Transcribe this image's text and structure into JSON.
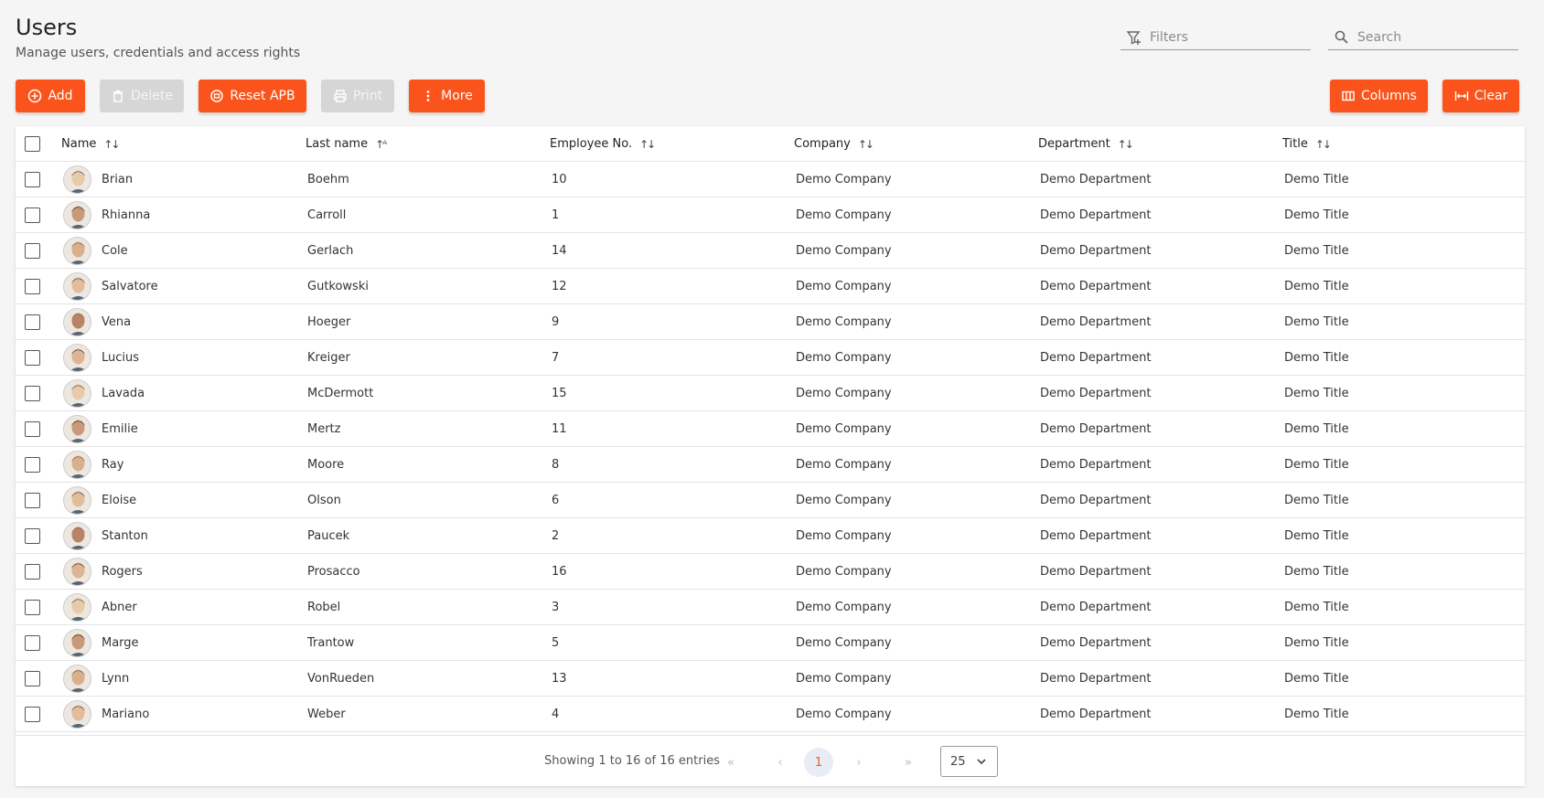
{
  "header": {
    "title": "Users",
    "subtitle": "Manage users, credentials and access rights"
  },
  "filters": {
    "placeholder": "Filters",
    "icon": "filter-plus-icon"
  },
  "search": {
    "placeholder": "Search",
    "icon": "search-icon"
  },
  "toolbar": {
    "add": "Add",
    "delete": "Delete",
    "reset_apb": "Reset APB",
    "print": "Print",
    "more": "More",
    "columns": "Columns",
    "clear": "Clear"
  },
  "colors": {
    "accent": "#fa541c",
    "disabled": "#d6d6d6",
    "active_page_bg": "#e8ecf5"
  },
  "table": {
    "columns": [
      "Name",
      "Last name",
      "Employee No.",
      "Company",
      "Department",
      "Title"
    ],
    "rows": [
      {
        "name": "Brian",
        "last": "Boehm",
        "no": "10",
        "company": "Demo Company",
        "dept": "Demo Department",
        "title": "Demo Title"
      },
      {
        "name": "Rhianna",
        "last": "Carroll",
        "no": "1",
        "company": "Demo Company",
        "dept": "Demo Department",
        "title": "Demo Title"
      },
      {
        "name": "Cole",
        "last": "Gerlach",
        "no": "14",
        "company": "Demo Company",
        "dept": "Demo Department",
        "title": "Demo Title"
      },
      {
        "name": "Salvatore",
        "last": "Gutkowski",
        "no": "12",
        "company": "Demo Company",
        "dept": "Demo Department",
        "title": "Demo Title"
      },
      {
        "name": "Vena",
        "last": "Hoeger",
        "no": "9",
        "company": "Demo Company",
        "dept": "Demo Department",
        "title": "Demo Title"
      },
      {
        "name": "Lucius",
        "last": "Kreiger",
        "no": "7",
        "company": "Demo Company",
        "dept": "Demo Department",
        "title": "Demo Title"
      },
      {
        "name": "Lavada",
        "last": "McDermott",
        "no": "15",
        "company": "Demo Company",
        "dept": "Demo Department",
        "title": "Demo Title"
      },
      {
        "name": "Emilie",
        "last": "Mertz",
        "no": "11",
        "company": "Demo Company",
        "dept": "Demo Department",
        "title": "Demo Title"
      },
      {
        "name": "Ray",
        "last": "Moore",
        "no": "8",
        "company": "Demo Company",
        "dept": "Demo Department",
        "title": "Demo Title"
      },
      {
        "name": "Eloise",
        "last": "Olson",
        "no": "6",
        "company": "Demo Company",
        "dept": "Demo Department",
        "title": "Demo Title"
      },
      {
        "name": "Stanton",
        "last": "Paucek",
        "no": "2",
        "company": "Demo Company",
        "dept": "Demo Department",
        "title": "Demo Title"
      },
      {
        "name": "Rogers",
        "last": "Prosacco",
        "no": "16",
        "company": "Demo Company",
        "dept": "Demo Department",
        "title": "Demo Title"
      },
      {
        "name": "Abner",
        "last": "Robel",
        "no": "3",
        "company": "Demo Company",
        "dept": "Demo Department",
        "title": "Demo Title"
      },
      {
        "name": "Marge",
        "last": "Trantow",
        "no": "5",
        "company": "Demo Company",
        "dept": "Demo Department",
        "title": "Demo Title"
      },
      {
        "name": "Lynn",
        "last": "VonRueden",
        "no": "13",
        "company": "Demo Company",
        "dept": "Demo Department",
        "title": "Demo Title"
      },
      {
        "name": "Mariano",
        "last": "Weber",
        "no": "4",
        "company": "Demo Company",
        "dept": "Demo Department",
        "title": "Demo Title"
      }
    ]
  },
  "pagination": {
    "summary": "Showing 1 to 16 of 16 entries",
    "first": "«",
    "prev": "‹",
    "current": "1",
    "next": "›",
    "last": "»",
    "page_size": "25"
  }
}
